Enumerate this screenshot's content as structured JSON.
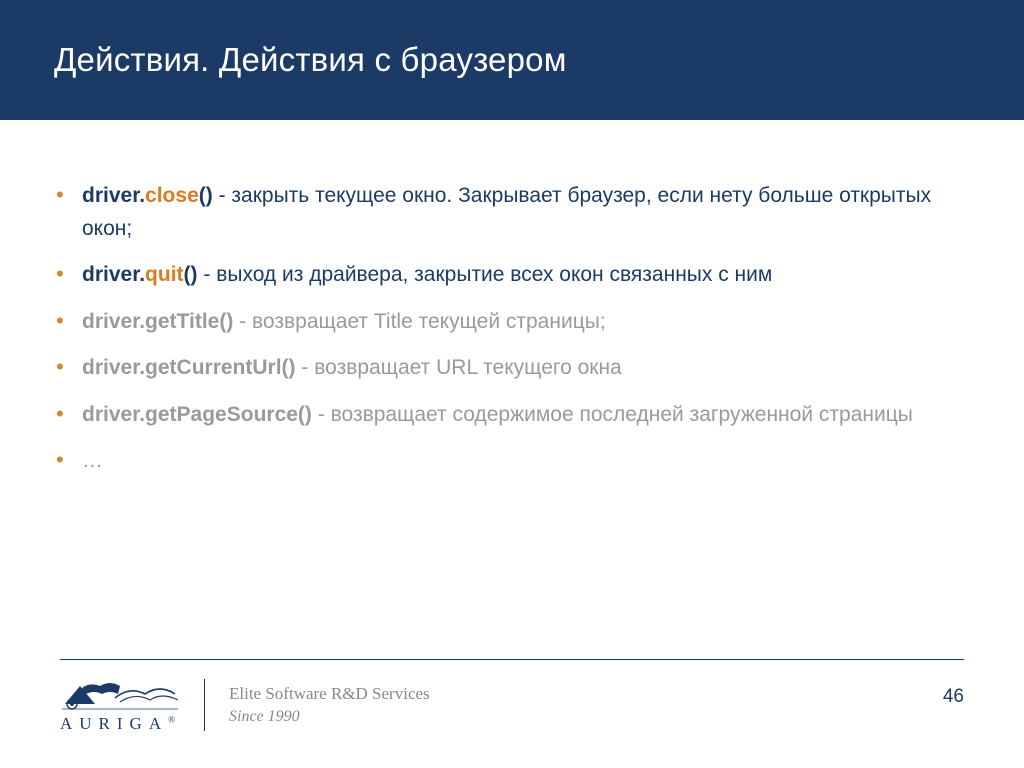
{
  "title": "Действия. Действия с браузером",
  "bullets": {
    "b1": {
      "prefix": "driver.",
      "method": "close",
      "suffix": "()",
      "desc": " - закрыть текущее окно. Закрывает браузер, если нету больше открытых окон;"
    },
    "b2": {
      "prefix": "driver.",
      "method": "quit",
      "suffix": "()",
      "desc": " - выход из драйвера, закрытие всех окон связанных с ним"
    },
    "b3": {
      "code": "driver.getTitle()",
      "desc": " - возвращает Title текущей страницы;"
    },
    "b4": {
      "code": "driver.getCurrentUrl()",
      "desc": " - возвращает URL текущего окна"
    },
    "b5": {
      "code": "driver.getPageSource()",
      "desc": " - возвращает содержимое последней загруженной страницы"
    },
    "b6": {
      "text": "…"
    }
  },
  "footer": {
    "logo_name": "AURIGA",
    "tagline1": "Elite Software R&D Services",
    "tagline2": "Since 1990",
    "page": "46"
  }
}
